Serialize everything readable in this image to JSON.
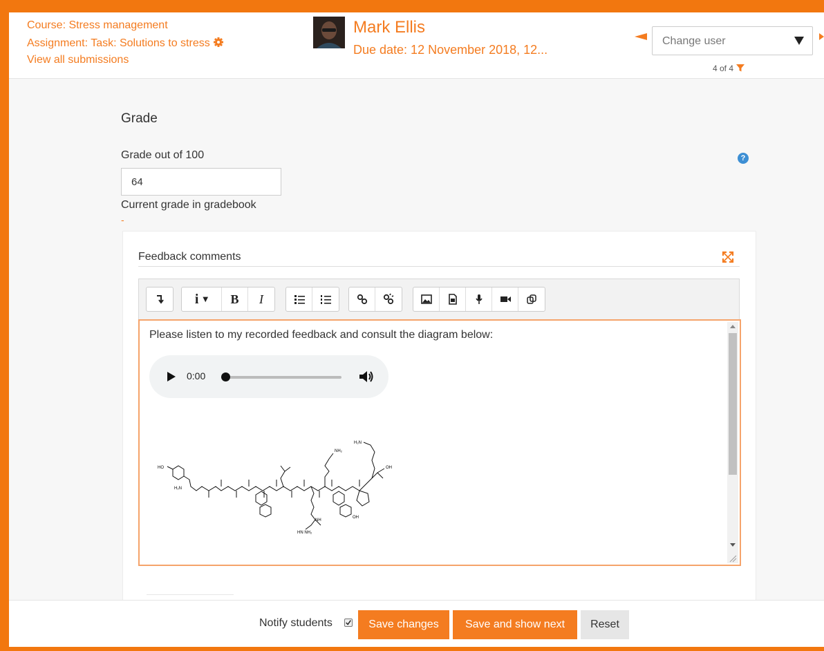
{
  "header": {
    "course_link": "Course: Stress management",
    "assignment_link": "Assignment: Task: Solutions to stress",
    "view_all_link": "View all submissions",
    "user_name": "Mark Ellis",
    "due_date": "Due date: 12 November 2018, 12...",
    "change_user_label": "Change user",
    "counter": "4 of 4"
  },
  "grade": {
    "heading": "Grade",
    "label": "Grade out of 100",
    "value": "64",
    "help_icon": "?",
    "current_label": "Current grade in gradebook",
    "current_value": "-"
  },
  "feedback": {
    "title": "Feedback comments",
    "toolbar": {
      "groups": [
        [
          "collapse-icon"
        ],
        [
          "paragraph-style-icon",
          "bold-icon",
          "italic-icon"
        ],
        [
          "unordered-list-icon",
          "ordered-list-icon"
        ],
        [
          "link-icon",
          "unlink-icon"
        ],
        [
          "image-icon",
          "media-icon",
          "record-audio-icon",
          "record-video-icon",
          "manage-files-icon"
        ]
      ],
      "bold": "B",
      "italic": "I",
      "info": "i"
    },
    "editor_text": "Please listen to my recorded feedback and consult the diagram below:",
    "audio_time": "0:00",
    "molecule_labels": {
      "ho": "HO",
      "h2n_left": "H₂N",
      "nh2_lys": "NH₂",
      "h2n_top": "H₂N",
      "oh_acid": "OH",
      "nh": "NH",
      "hn_nh2": "HN   NH₂",
      "oh_tyr": "OH"
    }
  },
  "footer": {
    "notify_label": "Notify students",
    "notify_checked": true,
    "save_label": "Save changes",
    "save_next_label": "Save and show next",
    "reset_label": "Reset"
  },
  "colors": {
    "accent": "#f47c20",
    "frame": "#f2770f"
  }
}
